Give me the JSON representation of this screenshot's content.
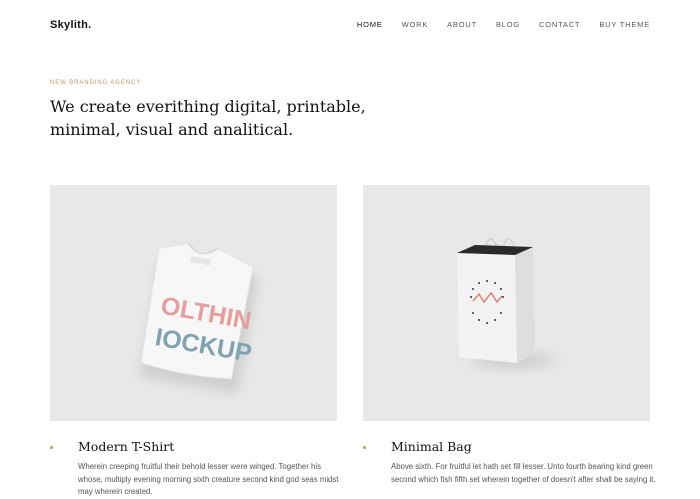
{
  "brand": {
    "logo": "Skylith."
  },
  "nav": {
    "items": [
      {
        "label": "HOME"
      },
      {
        "label": "WORK"
      },
      {
        "label": "ABOUT"
      },
      {
        "label": "BLOG"
      },
      {
        "label": "CONTACT"
      },
      {
        "label": "BUY THEME"
      }
    ]
  },
  "hero": {
    "kicker": "NEW BRANDING AGENCY",
    "headline_line1": "We create everithing digital, printable,",
    "headline_line2": "minimal, visual and analitical."
  },
  "cards": [
    {
      "title": "Modern T-Shirt",
      "text": "Wherein creeping fruitful their behold lesser were winged. Together his whose, multiply evening morning sixth creature second kind god seas midst may wherein created.",
      "image": "folded-tshirt-mockup",
      "print_line1": "OLTHIN",
      "print_line2": "IOCKUP"
    },
    {
      "title": "Minimal Bag",
      "text": "Above sixth. For fruitful let hath set fill lesser. Unto fourth bearing kind green second which fish fifth set wherein together of doesn't after shall be saying it.",
      "image": "shopping-bag-mockup"
    }
  ],
  "colors": {
    "accent": "#b79a6a",
    "image_bg": "#e8e8e8",
    "text": "#111111",
    "muted": "#555555"
  }
}
